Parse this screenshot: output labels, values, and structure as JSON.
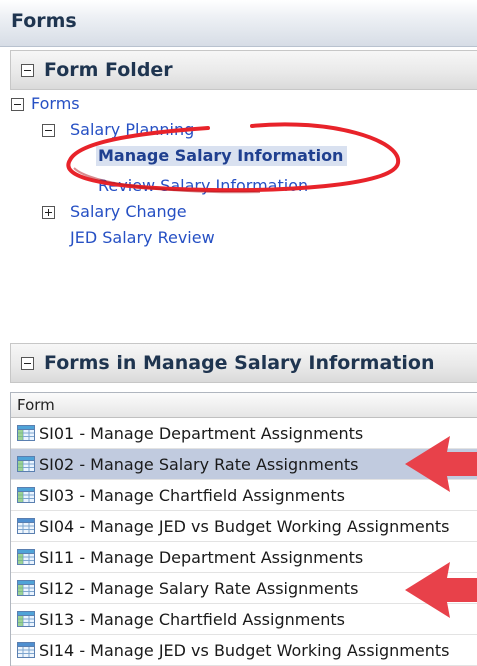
{
  "header": {
    "title": "Forms"
  },
  "folder_panel": {
    "title": "Form Folder",
    "tree": {
      "root": "Forms",
      "salary_planning": "Salary Planning",
      "manage_salary_information": "Manage Salary Information",
      "review_salary_information": "Review Salary Information",
      "salary_change": "Salary Change",
      "jed_salary_review": "JED Salary Review"
    }
  },
  "forms_panel": {
    "title": "Forms in Manage Salary Information",
    "column_header": "Form",
    "rows": [
      "SI01 - Manage Department Assignments",
      "SI02 - Manage Salary Rate Assignments",
      "SI03 - Manage Chartfield Assignments",
      "SI04 - Manage JED vs Budget Working Assignments",
      "SI11 - Manage Department Assignments",
      "SI12 - Manage Salary Rate Assignments",
      "SI13 - Manage Chartfield Assignments",
      "SI14 - Manage JED vs Budget Working Assignments"
    ]
  },
  "annotations": {
    "highlight_color": "#e8232a",
    "arrow_color": "#e8414a"
  }
}
